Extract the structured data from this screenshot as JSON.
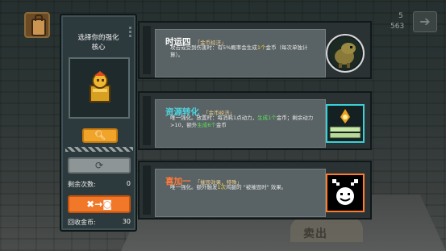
{
  "top_right": {
    "count_a": "5",
    "count_b": "563",
    "next_icon": "arrow-right-icon"
  },
  "panel": {
    "title_line1": "选择你的强化",
    "title_line2": "核心",
    "reroll_label": "剩余次数:",
    "reroll_value": "0",
    "recycle_label": "回收金币:",
    "recycle_value": "30"
  },
  "cards": [
    {
      "name": "时运四",
      "tag": "「金币经济」",
      "desc_before": "攻击或受到伤害时：有5%概率会生成",
      "desc_hl": "1个",
      "desc_after": "金币（每次单独计算）。",
      "accent": "#d8d8d8"
    },
    {
      "name": "资源转化",
      "tag": "「金币经济」",
      "desc_before": "唯一强化。放置时：每消耗1点动力，",
      "desc_hl": "生成1个",
      "desc_mid": "金币；剩余动力>10，额外",
      "desc_hl2": "生成6个",
      "desc_after": "金币",
      "accent": "#3ad1d6"
    },
    {
      "name": "喜加一",
      "tag": "「摧毁效果，特殊」",
      "desc_before": "唯一强化。额外触发",
      "desc_hl": "1次",
      "desc_after": "鸡腿的 \"被摧毁时\" 效果。",
      "accent": "#ff7a2a"
    }
  ],
  "background": {
    "sign_text": "卖出"
  }
}
